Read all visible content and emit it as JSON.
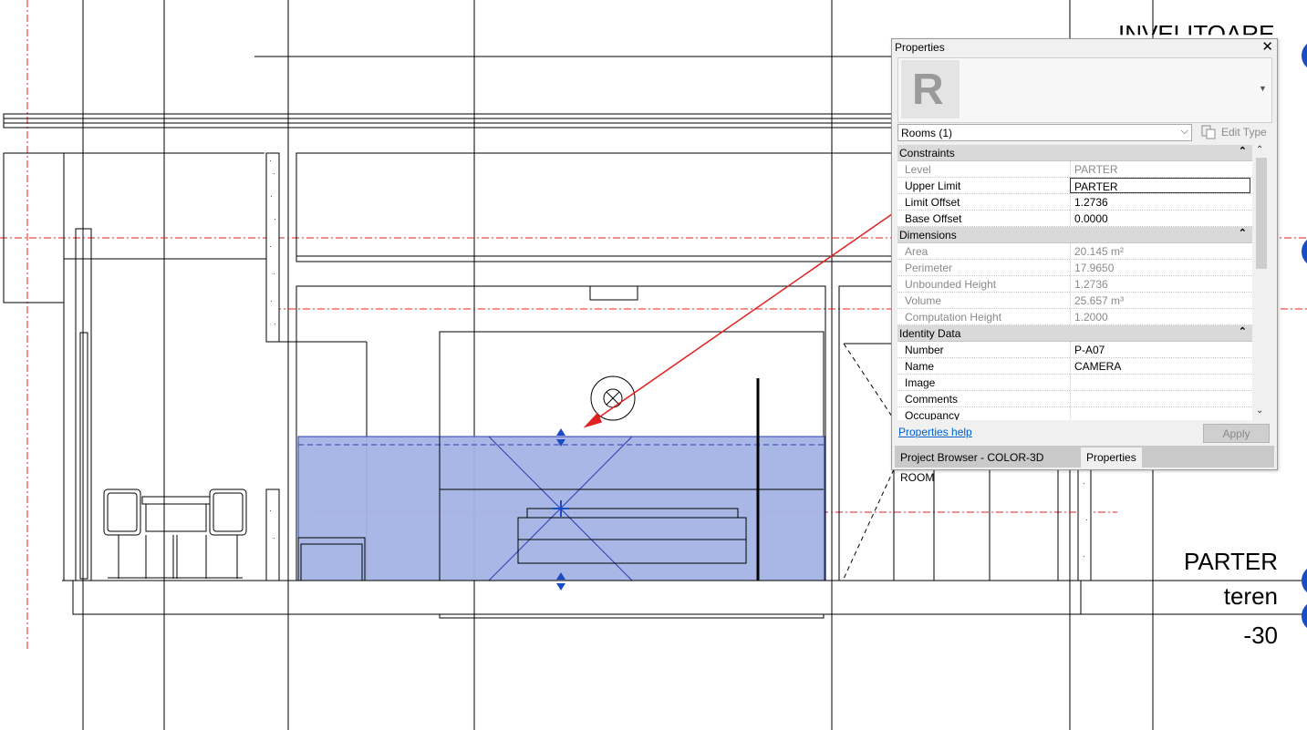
{
  "drawing": {
    "level_labels": {
      "top": "INVELITOARE",
      "parter": "PARTER",
      "teren": "teren",
      "elevation": "-30"
    },
    "colors": {
      "room_fill": "#a3b3e4",
      "room_line": "#2b3fb0",
      "reference_plane": "#e02020",
      "leader_arrow": "#e02020",
      "grip": "#1a4cc4"
    },
    "icons": {
      "room_tag": "room-tag-circle-icon",
      "height_grip": "height-grip-icon",
      "move_grip": "move-grip-icon"
    }
  },
  "properties": {
    "title": "Properties",
    "close_icon": "close-icon",
    "type_logo_letter": "R",
    "type_selector": "Rooms (1)",
    "edit_type": "Edit Type",
    "groups": [
      {
        "label": "Constraints",
        "rows": [
          {
            "name": "Level",
            "value": "PARTER"
          },
          {
            "name": "Upper Limit",
            "value": "PARTER"
          },
          {
            "name": "Limit Offset",
            "value": "1.2736"
          },
          {
            "name": "Base Offset",
            "value": "0.0000"
          }
        ]
      },
      {
        "label": "Dimensions",
        "rows": [
          {
            "name": "Area",
            "value": "20.145 m²"
          },
          {
            "name": "Perimeter",
            "value": "17.9650"
          },
          {
            "name": "Unbounded Height",
            "value": "1.2736"
          },
          {
            "name": "Volume",
            "value": "25.657 m³"
          },
          {
            "name": "Computation Height",
            "value": "1.2000"
          }
        ]
      },
      {
        "label": "Identity Data",
        "rows": [
          {
            "name": "Number",
            "value": "P-A07"
          },
          {
            "name": "Name",
            "value": "CAMERA"
          },
          {
            "name": "Image",
            "value": ""
          },
          {
            "name": "Comments",
            "value": ""
          },
          {
            "name": "Occupancy",
            "value": ""
          }
        ]
      }
    ],
    "help_link": "Properties help",
    "apply": "Apply",
    "tabs": {
      "browser": "Project Browser - COLOR-3D ROOM",
      "properties": "Properties"
    }
  }
}
